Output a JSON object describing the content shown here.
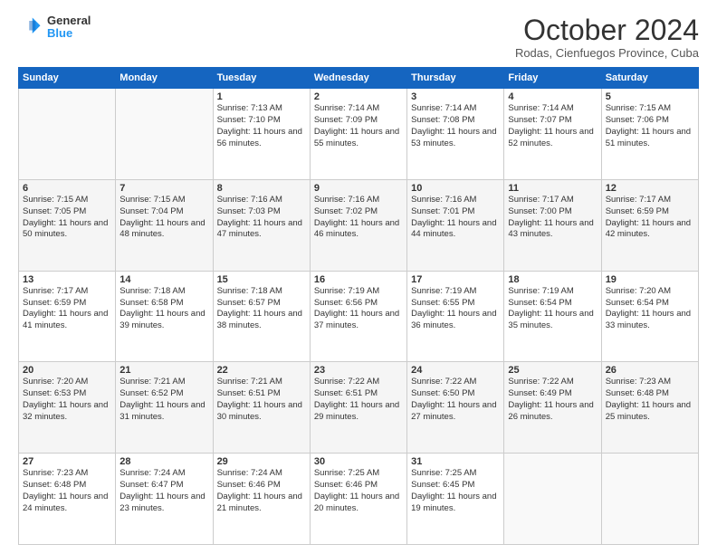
{
  "header": {
    "logo": {
      "general": "General",
      "blue": "Blue"
    },
    "title": "October 2024",
    "location": "Rodas, Cienfuegos Province, Cuba"
  },
  "days_of_week": [
    "Sunday",
    "Monday",
    "Tuesday",
    "Wednesday",
    "Thursday",
    "Friday",
    "Saturday"
  ],
  "weeks": [
    [
      {
        "day": "",
        "info": ""
      },
      {
        "day": "",
        "info": ""
      },
      {
        "day": "1",
        "info": "Sunrise: 7:13 AM\nSunset: 7:10 PM\nDaylight: 11 hours and 56 minutes."
      },
      {
        "day": "2",
        "info": "Sunrise: 7:14 AM\nSunset: 7:09 PM\nDaylight: 11 hours and 55 minutes."
      },
      {
        "day": "3",
        "info": "Sunrise: 7:14 AM\nSunset: 7:08 PM\nDaylight: 11 hours and 53 minutes."
      },
      {
        "day": "4",
        "info": "Sunrise: 7:14 AM\nSunset: 7:07 PM\nDaylight: 11 hours and 52 minutes."
      },
      {
        "day": "5",
        "info": "Sunrise: 7:15 AM\nSunset: 7:06 PM\nDaylight: 11 hours and 51 minutes."
      }
    ],
    [
      {
        "day": "6",
        "info": "Sunrise: 7:15 AM\nSunset: 7:05 PM\nDaylight: 11 hours and 50 minutes."
      },
      {
        "day": "7",
        "info": "Sunrise: 7:15 AM\nSunset: 7:04 PM\nDaylight: 11 hours and 48 minutes."
      },
      {
        "day": "8",
        "info": "Sunrise: 7:16 AM\nSunset: 7:03 PM\nDaylight: 11 hours and 47 minutes."
      },
      {
        "day": "9",
        "info": "Sunrise: 7:16 AM\nSunset: 7:02 PM\nDaylight: 11 hours and 46 minutes."
      },
      {
        "day": "10",
        "info": "Sunrise: 7:16 AM\nSunset: 7:01 PM\nDaylight: 11 hours and 44 minutes."
      },
      {
        "day": "11",
        "info": "Sunrise: 7:17 AM\nSunset: 7:00 PM\nDaylight: 11 hours and 43 minutes."
      },
      {
        "day": "12",
        "info": "Sunrise: 7:17 AM\nSunset: 6:59 PM\nDaylight: 11 hours and 42 minutes."
      }
    ],
    [
      {
        "day": "13",
        "info": "Sunrise: 7:17 AM\nSunset: 6:59 PM\nDaylight: 11 hours and 41 minutes."
      },
      {
        "day": "14",
        "info": "Sunrise: 7:18 AM\nSunset: 6:58 PM\nDaylight: 11 hours and 39 minutes."
      },
      {
        "day": "15",
        "info": "Sunrise: 7:18 AM\nSunset: 6:57 PM\nDaylight: 11 hours and 38 minutes."
      },
      {
        "day": "16",
        "info": "Sunrise: 7:19 AM\nSunset: 6:56 PM\nDaylight: 11 hours and 37 minutes."
      },
      {
        "day": "17",
        "info": "Sunrise: 7:19 AM\nSunset: 6:55 PM\nDaylight: 11 hours and 36 minutes."
      },
      {
        "day": "18",
        "info": "Sunrise: 7:19 AM\nSunset: 6:54 PM\nDaylight: 11 hours and 35 minutes."
      },
      {
        "day": "19",
        "info": "Sunrise: 7:20 AM\nSunset: 6:54 PM\nDaylight: 11 hours and 33 minutes."
      }
    ],
    [
      {
        "day": "20",
        "info": "Sunrise: 7:20 AM\nSunset: 6:53 PM\nDaylight: 11 hours and 32 minutes."
      },
      {
        "day": "21",
        "info": "Sunrise: 7:21 AM\nSunset: 6:52 PM\nDaylight: 11 hours and 31 minutes."
      },
      {
        "day": "22",
        "info": "Sunrise: 7:21 AM\nSunset: 6:51 PM\nDaylight: 11 hours and 30 minutes."
      },
      {
        "day": "23",
        "info": "Sunrise: 7:22 AM\nSunset: 6:51 PM\nDaylight: 11 hours and 29 minutes."
      },
      {
        "day": "24",
        "info": "Sunrise: 7:22 AM\nSunset: 6:50 PM\nDaylight: 11 hours and 27 minutes."
      },
      {
        "day": "25",
        "info": "Sunrise: 7:22 AM\nSunset: 6:49 PM\nDaylight: 11 hours and 26 minutes."
      },
      {
        "day": "26",
        "info": "Sunrise: 7:23 AM\nSunset: 6:48 PM\nDaylight: 11 hours and 25 minutes."
      }
    ],
    [
      {
        "day": "27",
        "info": "Sunrise: 7:23 AM\nSunset: 6:48 PM\nDaylight: 11 hours and 24 minutes."
      },
      {
        "day": "28",
        "info": "Sunrise: 7:24 AM\nSunset: 6:47 PM\nDaylight: 11 hours and 23 minutes."
      },
      {
        "day": "29",
        "info": "Sunrise: 7:24 AM\nSunset: 6:46 PM\nDaylight: 11 hours and 21 minutes."
      },
      {
        "day": "30",
        "info": "Sunrise: 7:25 AM\nSunset: 6:46 PM\nDaylight: 11 hours and 20 minutes."
      },
      {
        "day": "31",
        "info": "Sunrise: 7:25 AM\nSunset: 6:45 PM\nDaylight: 11 hours and 19 minutes."
      },
      {
        "day": "",
        "info": ""
      },
      {
        "day": "",
        "info": ""
      }
    ]
  ]
}
